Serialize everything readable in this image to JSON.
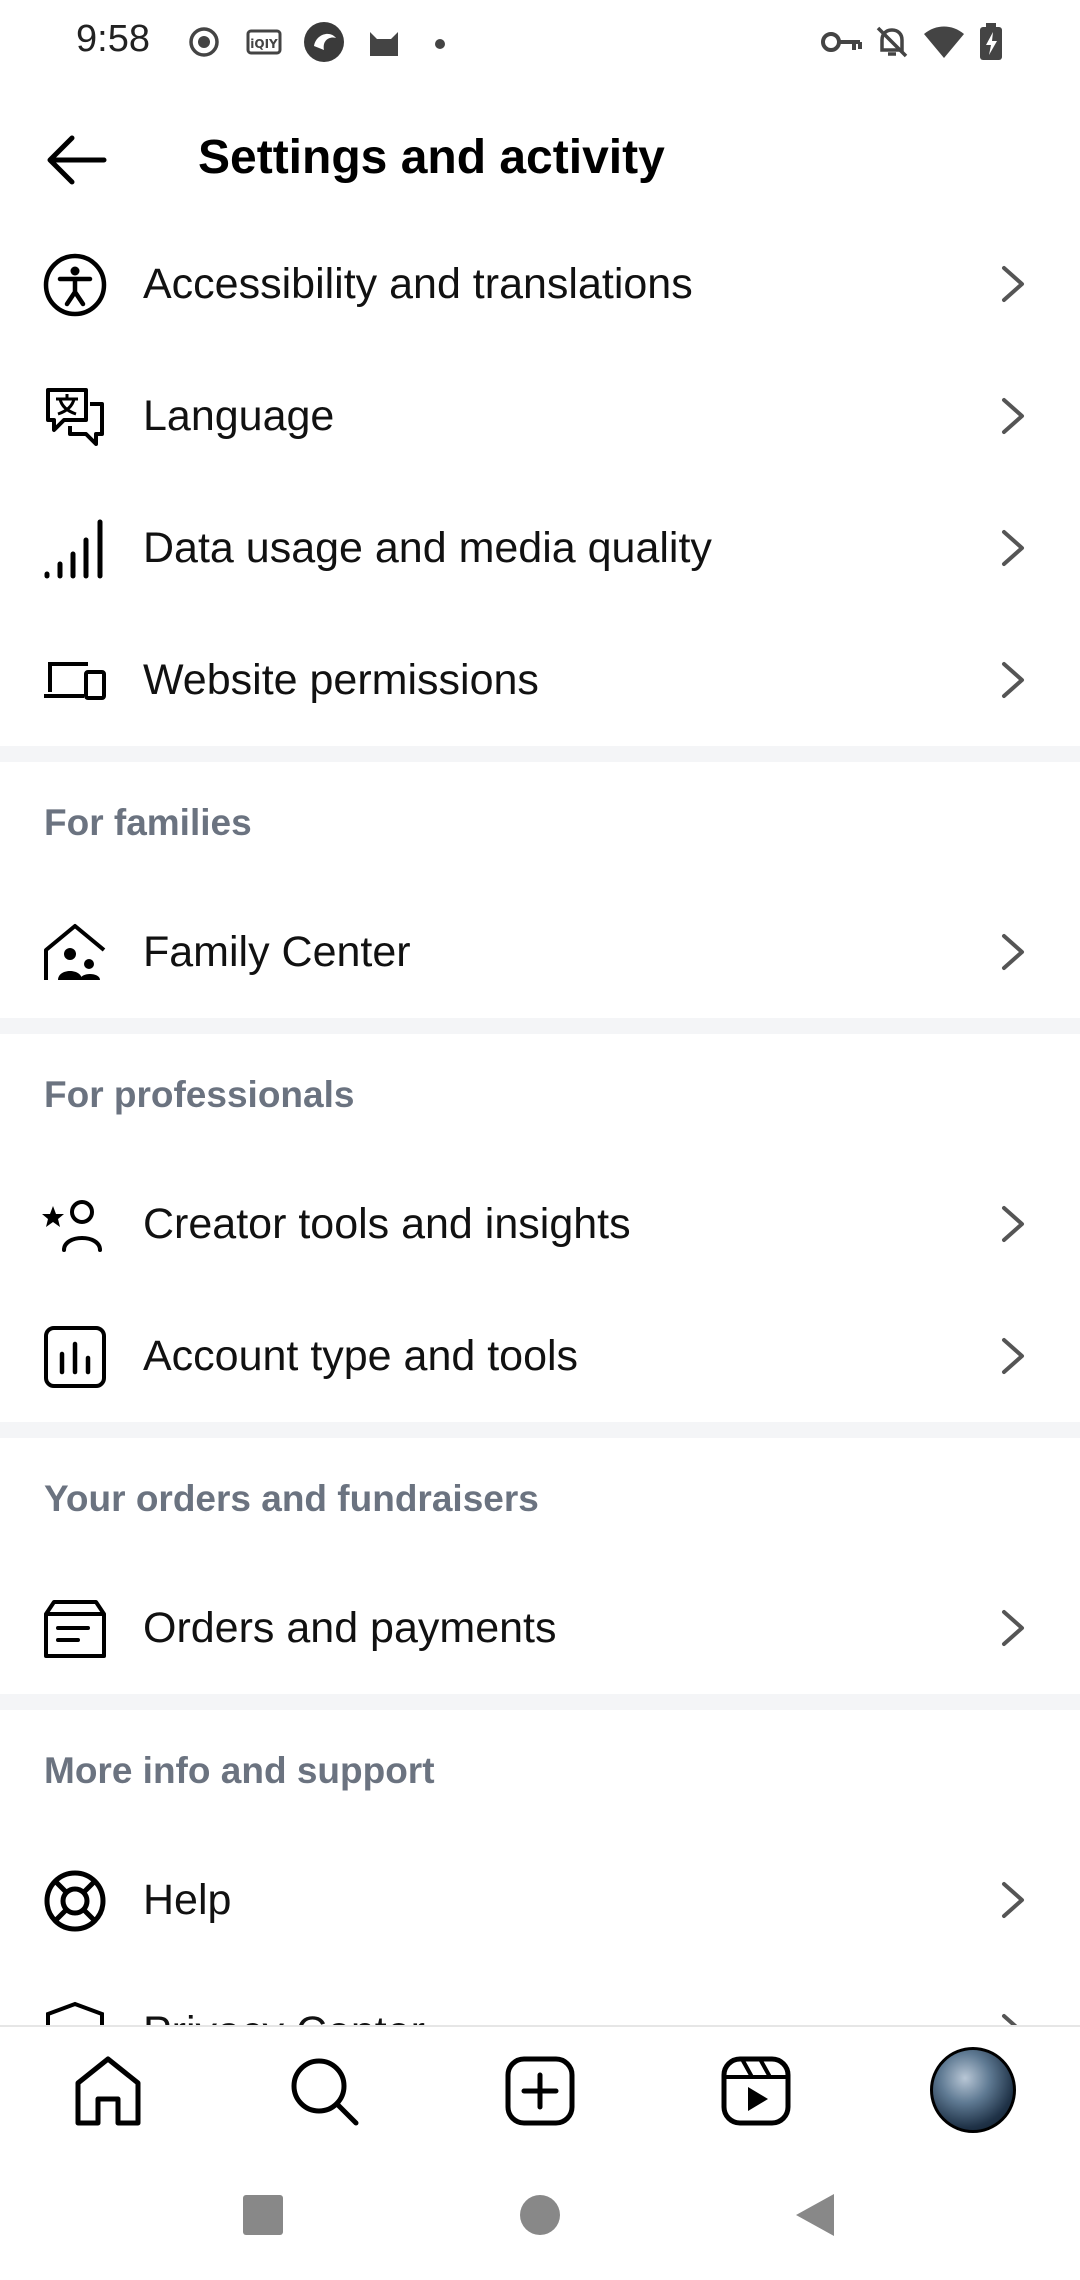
{
  "status_bar": {
    "time": "9:58",
    "left_icons": [
      "record-icon",
      "iqiyi-icon",
      "app-icon",
      "cat-icon",
      "dot-icon"
    ],
    "right_icons": [
      "vpn-key-icon",
      "bell-off-icon",
      "wifi-icon",
      "battery-charging-icon"
    ]
  },
  "header": {
    "title": "Settings and activity"
  },
  "rows_top": [
    {
      "label": "Accessibility and translations",
      "icon": "accessibility-icon"
    },
    {
      "label": "Language",
      "icon": "translate-icon"
    },
    {
      "label": "Data usage and media quality",
      "icon": "signal-bars-icon"
    },
    {
      "label": "Website permissions",
      "icon": "devices-icon"
    }
  ],
  "sections": {
    "families": {
      "header": "For families",
      "items": [
        {
          "label": "Family Center",
          "icon": "family-home-icon"
        }
      ]
    },
    "professionals": {
      "header": "For professionals",
      "items": [
        {
          "label": "Creator tools and insights",
          "icon": "creator-star-icon"
        },
        {
          "label": "Account type and tools",
          "icon": "bar-chart-icon"
        }
      ]
    },
    "orders": {
      "header": "Your orders and fundraisers",
      "items": [
        {
          "label": "Orders and payments",
          "icon": "orders-icon"
        }
      ]
    },
    "support": {
      "header": "More info and support",
      "items": [
        {
          "label": "Help",
          "icon": "lifebuoy-icon"
        },
        {
          "label": "Privacy Center",
          "icon": "shield-icon"
        }
      ]
    }
  },
  "bottom_nav": [
    "home-icon",
    "search-icon",
    "create-icon",
    "reels-icon",
    "profile-avatar"
  ],
  "system_nav": [
    "recents-icon",
    "home-circle-icon",
    "back-triangle-icon"
  ]
}
